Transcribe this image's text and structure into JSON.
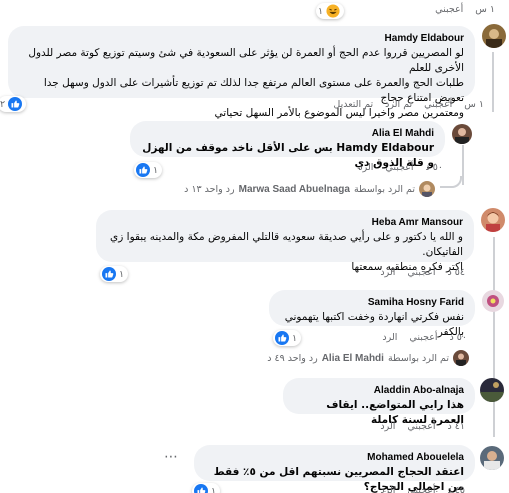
{
  "colors": {
    "like_blue": "#1877f2",
    "haha_yellow": "#f7b125",
    "bubble_bg": "#f0f2f5",
    "meta_grey": "#65676b",
    "thread_line": "#ced0d4"
  },
  "top": {
    "time": "١ س",
    "like": "أعجبني",
    "react_count": "١"
  },
  "hamdy": {
    "author": "Hamdy Eldabour",
    "text": "لو المصريين قرروا عدم الحج أو العمرة لن يؤثر على السعودية في شئ وسيتم توزيع كوتة مصر للدول الأخرى للعلم\nطلبات الحج والعمرة على مستوى العالم مرتفع جدا لذلك تم توزيع تأشيرات على الدول وسهل جدا تعويض امتناع حجاج\nومعتمرين مصر واخيرا ليس الموضوع بالأمر السهل تحياتي",
    "time": "١ س",
    "like": "أعجبني",
    "reply": "تم الرد",
    "edited": "تم التعديل",
    "react_count": "٢"
  },
  "alia": {
    "author": "Alia El Mahdi",
    "text": "Hamdy Eldabour بس على الأقل ناخد موقف من الهزل و قلة الذوق دي",
    "time": "٥٠ د",
    "like": "أعجبني",
    "reply": "الرد",
    "react_count": "١"
  },
  "alia_replies": {
    "by": "تم الرد بواسطة",
    "name": "Marwa Saad Abuelnaga",
    "count": "رد واحد ١٣ د"
  },
  "heba": {
    "author": "Heba Amr Mansour",
    "text": "و الله يا دكتور و على رأيي صديقة سعوديه قالتلي المفروض مكة والمدينه يبقوا زي الفاتيكان.\nاكتر فكره منطقيه سمعتها",
    "time": "٥٤ د",
    "like": "أعجبني",
    "reply": "الرد",
    "react_count": "١"
  },
  "samiha": {
    "author": "Samiha Hosny Farid",
    "text": "نفس فكرتي انهاردة وخفت اكتبها يتهموني بالكفر",
    "time": "٥٠ د",
    "like": "أعجبني",
    "reply": "الرد",
    "react_count": "١"
  },
  "samiha_replies": {
    "by": "تم الرد بواسطة",
    "name": "Alia El Mahdi",
    "count": "رد واحد ٤٩ د"
  },
  "aladdin": {
    "author": "Aladdin Abo-alnaja",
    "text": "هذا رايي المتواضع.. ايقاف العمرة لسنة كاملة",
    "time": "٤١ د",
    "like": "أعجبني",
    "reply": "الرد"
  },
  "mohamed": {
    "author": "Mohamed Abouelela",
    "text": "اعتقد الحجاج المصريين نسبتهم اقل من ٥٪ فقط من اجمالي الحجاج؟",
    "time": "٤٥ د",
    "like": "أعجبني",
    "reply": "الرد",
    "react_count": "١"
  }
}
